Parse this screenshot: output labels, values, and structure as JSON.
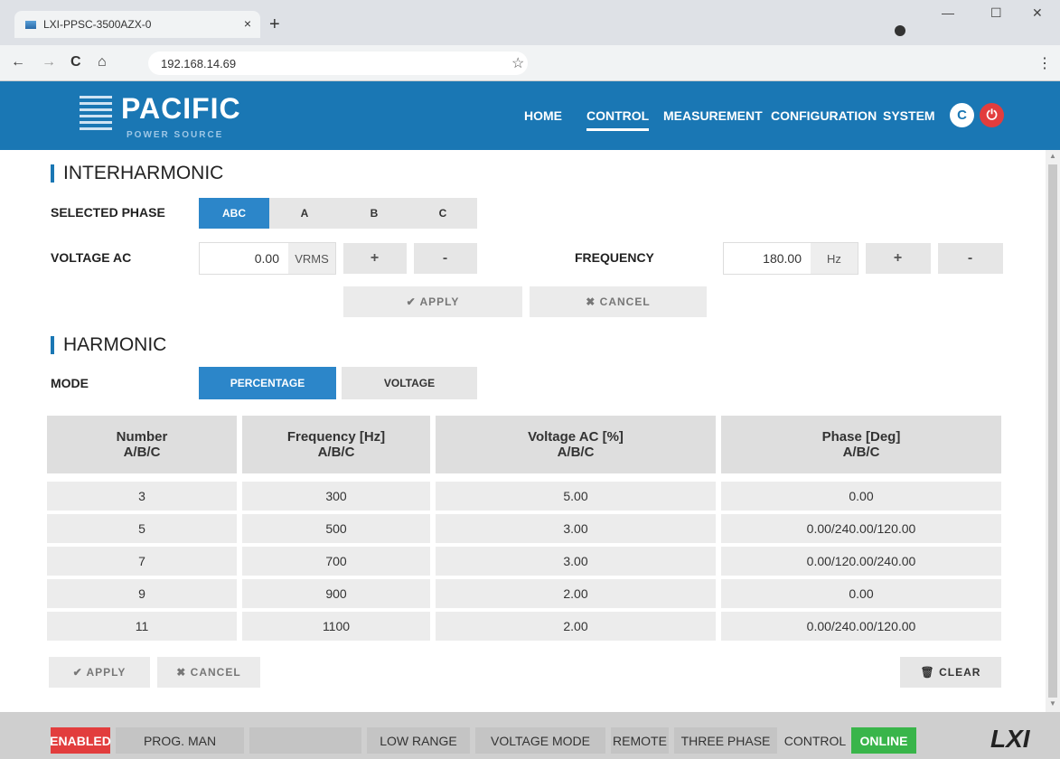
{
  "browser": {
    "tab_title": "LXI-PPSC-3500AZX-0",
    "tab_close": "×",
    "new_tab": "+",
    "url": "192.168.14.69",
    "star": "☆",
    "menu": "⋮",
    "back": "←",
    "forward": "→",
    "reload": "C",
    "home": "⌂",
    "minimize": "—",
    "maximize": "☐",
    "close": "✕"
  },
  "header": {
    "logo_title": "PACIFIC",
    "logo_subtitle": "POWER SOURCE",
    "nav": [
      {
        "label": "HOME"
      },
      {
        "label": "CONTROL"
      },
      {
        "label": "MEASUREMENT"
      },
      {
        "label": "CONFIGURATION"
      },
      {
        "label": "SYSTEM"
      }
    ],
    "refresh_icon": "C",
    "power_icon": "⏻"
  },
  "interharmonic": {
    "title": "INTERHARMONIC",
    "selected_phase_label": "SELECTED PHASE",
    "phases": [
      "ABC",
      "A",
      "B",
      "C"
    ],
    "voltage_label": "VOLTAGE AC",
    "voltage_value": "0.00",
    "voltage_unit": "VRMS",
    "frequency_label": "FREQUENCY",
    "frequency_value": "180.00",
    "frequency_unit": "Hz",
    "plus": "+",
    "minus": "-",
    "apply": "✔ APPLY",
    "cancel": "✖ CANCEL"
  },
  "harmonic": {
    "title": "HARMONIC",
    "mode_label": "MODE",
    "modes": [
      "PERCENTAGE",
      "VOLTAGE"
    ],
    "columns": [
      {
        "line1": "Number",
        "line2": "A/B/C"
      },
      {
        "line1": "Frequency [Hz]",
        "line2": "A/B/C"
      },
      {
        "line1": "Voltage AC [%]",
        "line2": "A/B/C"
      },
      {
        "line1": "Phase [Deg]",
        "line2": "A/B/C"
      }
    ],
    "rows": [
      [
        "3",
        "300",
        "5.00",
        "0.00"
      ],
      [
        "5",
        "500",
        "3.00",
        "0.00/240.00/120.00"
      ],
      [
        "7",
        "700",
        "3.00",
        "0.00/120.00/240.00"
      ],
      [
        "9",
        "900",
        "2.00",
        "0.00"
      ],
      [
        "11",
        "1100",
        "2.00",
        "0.00/240.00/120.00"
      ]
    ],
    "apply": "✔ APPLY",
    "cancel": "✖ CANCEL",
    "clear": "🗑 CLEAR"
  },
  "status": {
    "enabled": "ENABLED",
    "prog": "PROG. MAN",
    "blank": "",
    "range": "LOW RANGE",
    "mode": "VOLTAGE MODE",
    "remote": "REMOTE",
    "phase": "THREE PHASE",
    "control": "CONTROL",
    "online": "ONLINE",
    "lxi": "LXI"
  },
  "colors": {
    "brand": "#1a77b4",
    "accent": "#2c86c9",
    "enabled": "#e23d3d",
    "online": "#39b54a"
  }
}
